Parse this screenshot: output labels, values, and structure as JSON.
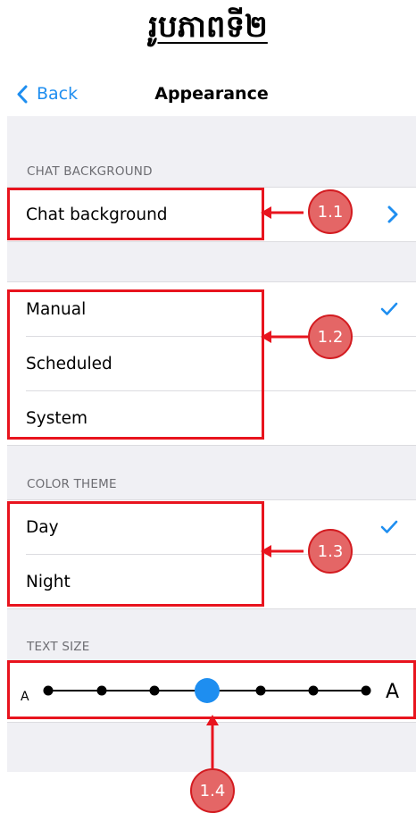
{
  "page_title": "រូបភាពទី២",
  "navbar": {
    "back_label": "Back",
    "title": "Appearance"
  },
  "chat_background": {
    "header": "CHAT BACKGROUND",
    "row_label": "Chat background"
  },
  "night_mode": {
    "options": [
      "Manual",
      "Scheduled",
      "System"
    ],
    "selected": "Manual"
  },
  "color_theme": {
    "header": "COLOR THEME",
    "options": [
      "Day",
      "Night"
    ],
    "selected": "Day"
  },
  "text_size": {
    "header": "TEXT SIZE",
    "small_label": "A",
    "large_label": "A",
    "steps": 7,
    "selected_step": 4
  },
  "annotations": [
    "1.1",
    "1.2",
    "1.3",
    "1.4"
  ],
  "colors": {
    "accent": "#1e8ef0",
    "callout": "#e8141e",
    "badge": "#e46666"
  },
  "icons": [
    "chevron-left-icon",
    "chevron-right-icon",
    "checkmark-icon"
  ]
}
